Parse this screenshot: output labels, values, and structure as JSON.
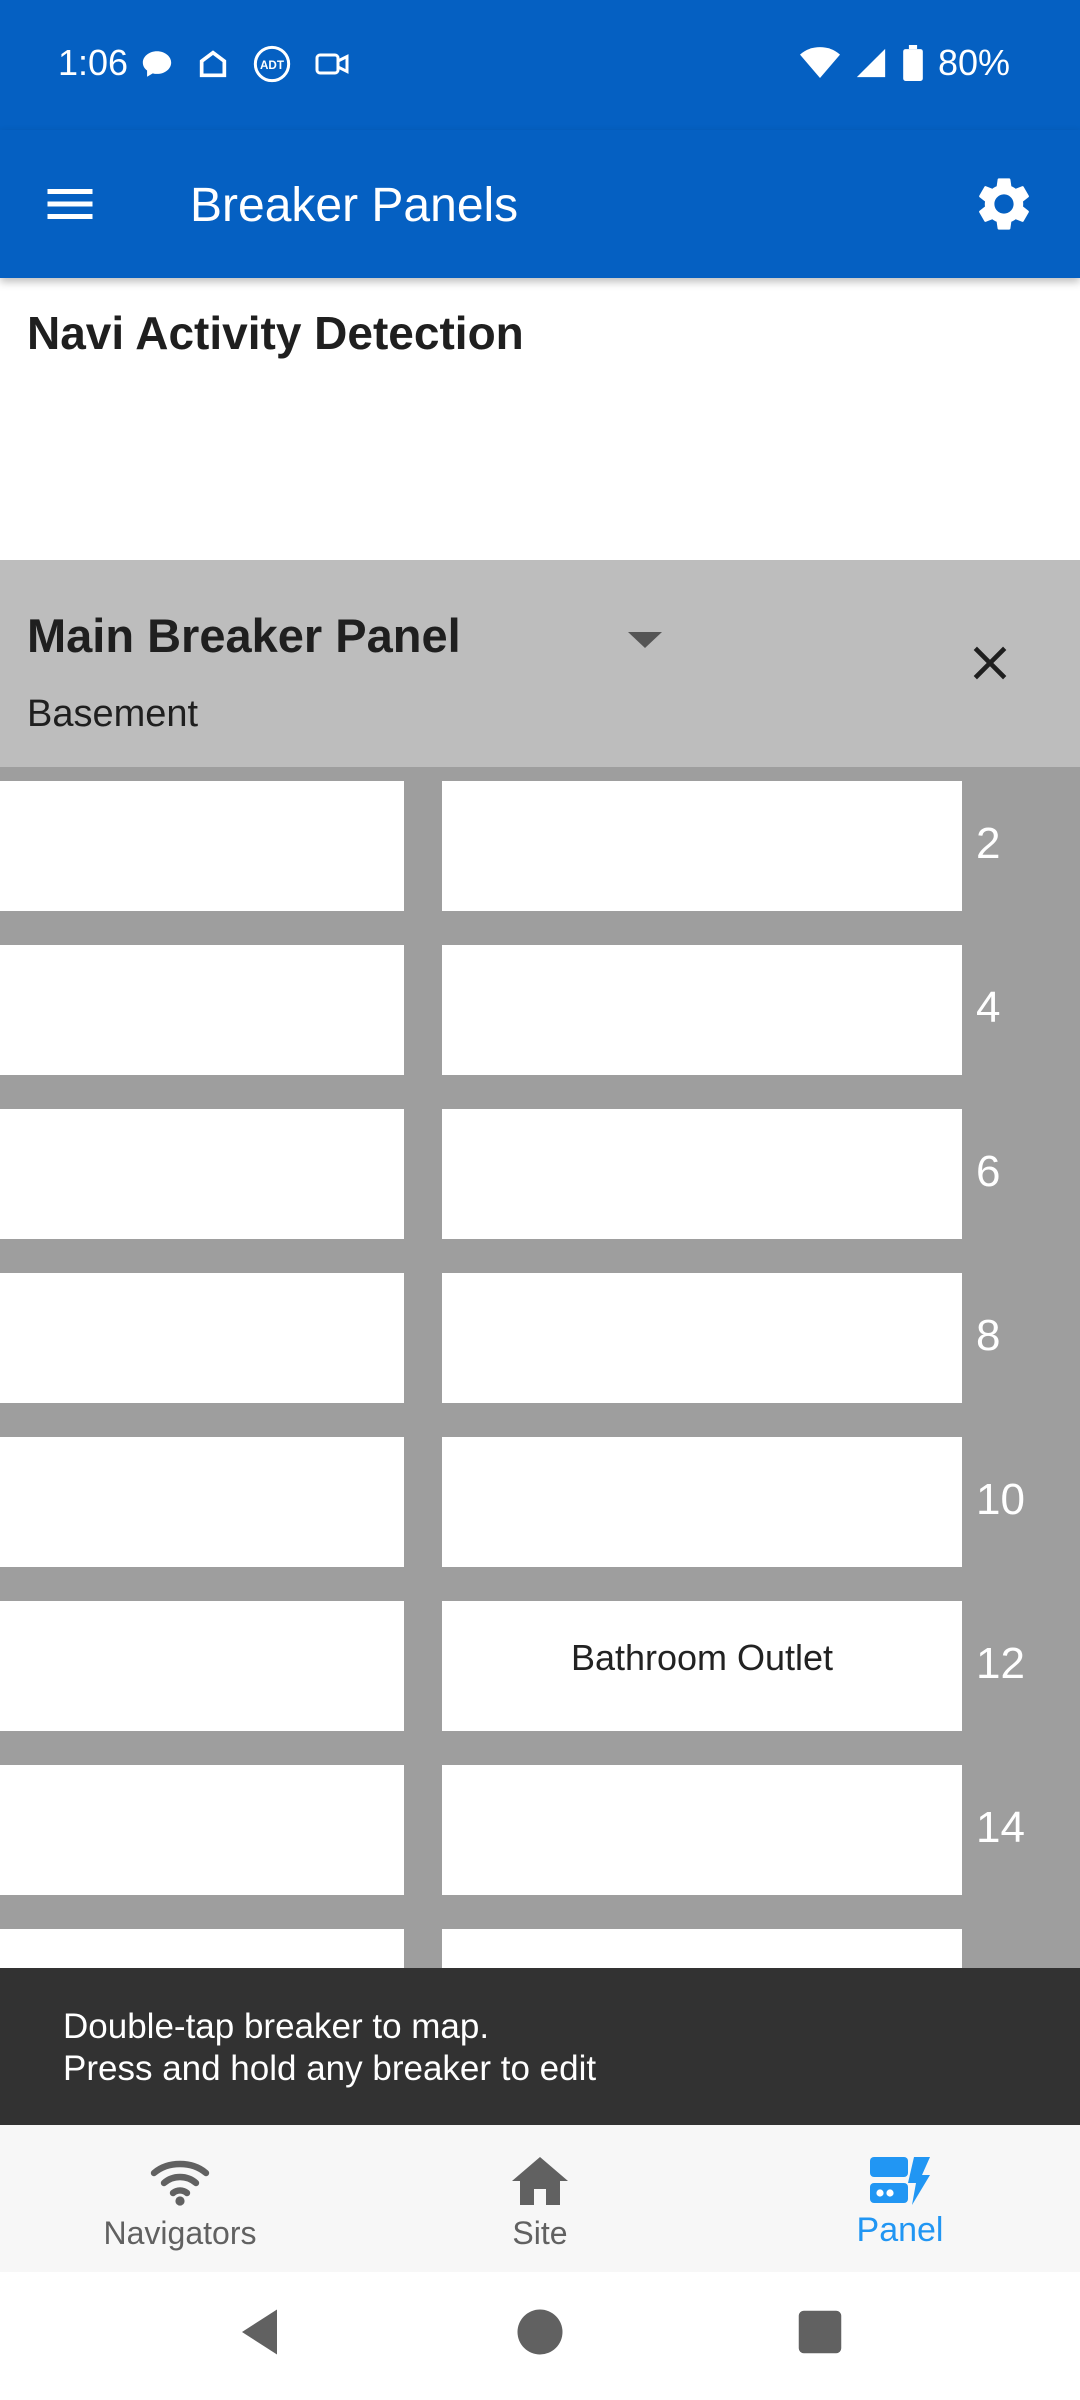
{
  "status_bar": {
    "time": "1:06",
    "battery": "80%"
  },
  "app_bar": {
    "title": "Breaker Panels"
  },
  "page": {
    "heading": "Navi Activity Detection"
  },
  "panel": {
    "name": "Main Breaker Panel",
    "location": "Basement"
  },
  "breakers": {
    "right": [
      {
        "number": "2",
        "label": ""
      },
      {
        "number": "4",
        "label": ""
      },
      {
        "number": "6",
        "label": ""
      },
      {
        "number": "8",
        "label": ""
      },
      {
        "number": "10",
        "label": ""
      },
      {
        "number": "12",
        "label": "Bathroom Outlet"
      },
      {
        "number": "14",
        "label": ""
      },
      {
        "number": "",
        "label": ""
      }
    ]
  },
  "toast": {
    "line1": "Double-tap breaker to map.",
    "line2": "Press and hold any breaker to edit"
  },
  "bottom_nav": {
    "items": [
      {
        "label": "Navigators",
        "icon": "wifi-icon",
        "active": false
      },
      {
        "label": "Site",
        "icon": "home-icon",
        "active": false
      },
      {
        "label": "Panel",
        "icon": "panel-icon",
        "active": true
      }
    ]
  },
  "colors": {
    "primary": "#0560c2",
    "active_nav": "#2196f3",
    "panel_header": "#bdbdbd",
    "breaker_bg": "#9e9e9e"
  }
}
